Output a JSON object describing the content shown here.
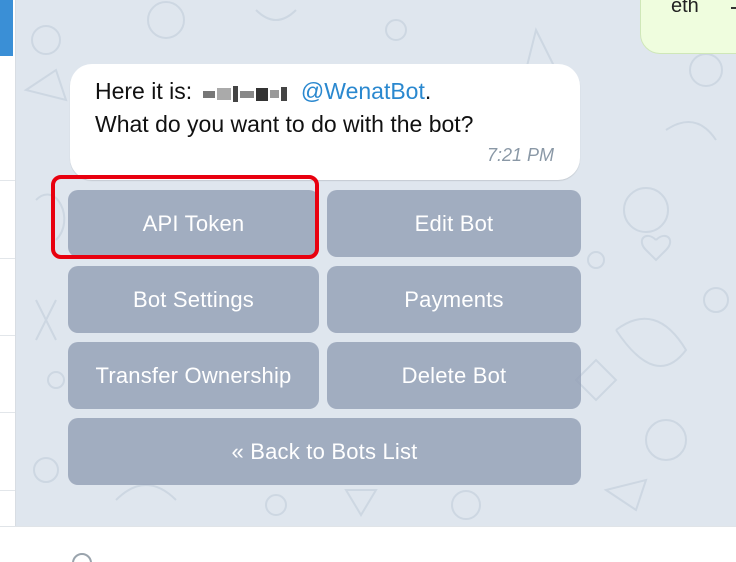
{
  "outgoing_message": {
    "text_fragment": "eth"
  },
  "message": {
    "prefix": "Here it is:",
    "bot_username": "@WenatBot",
    "suffix": ".",
    "question": "What do you want to do with the bot?",
    "time": "7:21 PM"
  },
  "keyboard": {
    "api_token": "API Token",
    "edit_bot": "Edit Bot",
    "bot_settings": "Bot Settings",
    "payments": "Payments",
    "transfer_ownership": "Transfer Ownership",
    "delete_bot": "Delete Bot",
    "back_to_bots_list": "« Back to Bots List"
  },
  "colors": {
    "chat_background": "#dfe6ee",
    "link": "#2a88cf",
    "keyboard_button": "#94a0b6",
    "highlight": "#e8000f",
    "outgoing_bubble": "#effdde"
  }
}
